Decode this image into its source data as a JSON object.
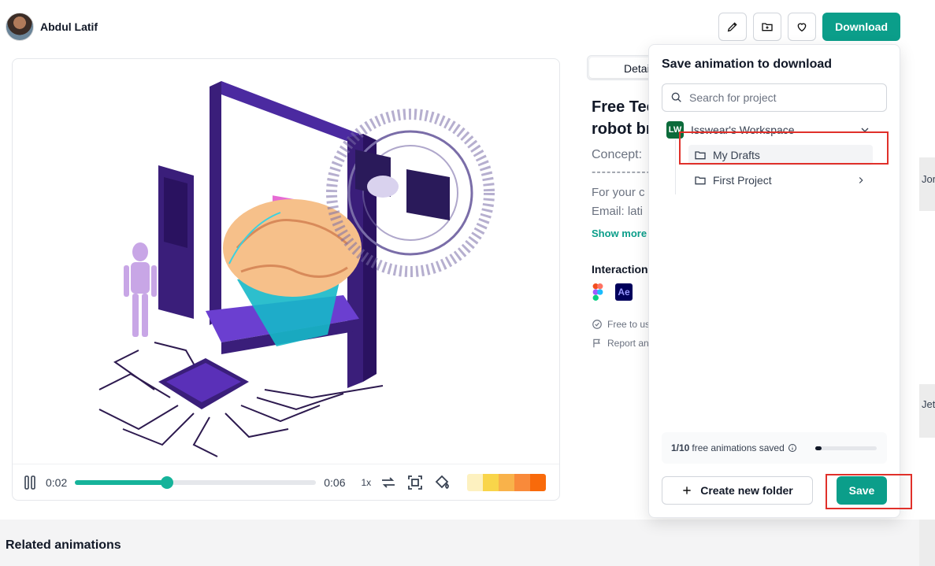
{
  "author": {
    "name": "Abdul Latif"
  },
  "toolbar": {
    "edit_icon": "pencil-icon",
    "save_folder_icon": "folder-plus-icon",
    "like_icon": "heart-icon",
    "download_label": "Download"
  },
  "player": {
    "current_time": "0:02",
    "total_time": "0:06",
    "progress_fraction": 0.38,
    "speed": "1x",
    "palette": [
      "#fdf1c0",
      "#f9d54a",
      "#f9b24a",
      "#f98a3a",
      "#f96a0a"
    ]
  },
  "details": {
    "tab_label": "Detai",
    "title_line1": "Free Tec",
    "title_line2": "robot br",
    "concept": "Concept:",
    "dashes": "------------",
    "line1": "For your c",
    "line2": "Email: lati",
    "show_more": "Show more",
    "interaction": "Interaction",
    "free_to_use": "Free to us",
    "report": "Report an"
  },
  "related": {
    "title": "Related animations"
  },
  "edge": {
    "text1": "Jor",
    "text2": "Jet"
  },
  "popup": {
    "title": "Save animation to download",
    "search_placeholder": "Search for project",
    "workspace": {
      "badge": "LW",
      "name": "Isswear's Workspace"
    },
    "folders": [
      {
        "name": "My Drafts",
        "selected": true
      },
      {
        "name": "First Project",
        "has_children": true
      }
    ],
    "quota": {
      "count": "1/10",
      "text": "free animations saved",
      "fraction": 0.1
    },
    "create_folder_label": "Create new folder",
    "save_label": "Save"
  }
}
